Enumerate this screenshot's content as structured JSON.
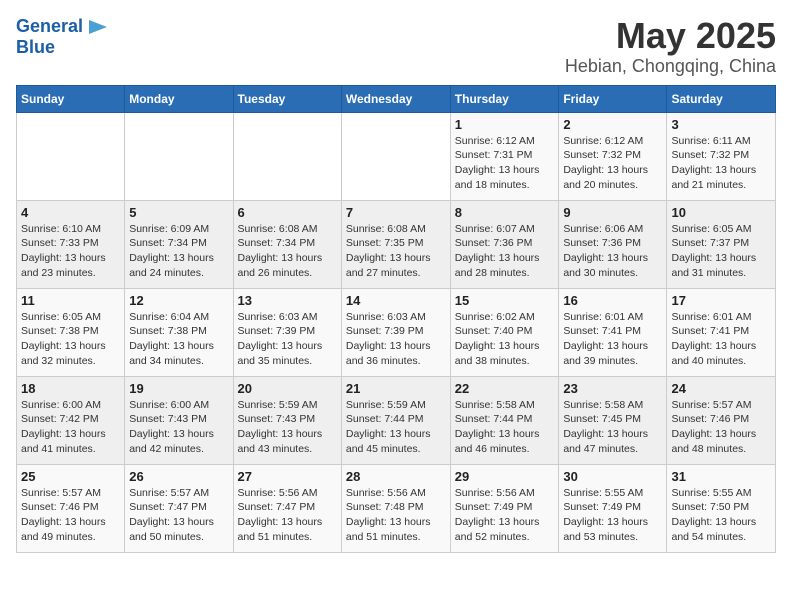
{
  "logo": {
    "line1": "General",
    "line2": "Blue"
  },
  "title": "May 2025",
  "subtitle": "Hebian, Chongqing, China",
  "days_of_week": [
    "Sunday",
    "Monday",
    "Tuesday",
    "Wednesday",
    "Thursday",
    "Friday",
    "Saturday"
  ],
  "weeks": [
    [
      {
        "num": "",
        "detail": ""
      },
      {
        "num": "",
        "detail": ""
      },
      {
        "num": "",
        "detail": ""
      },
      {
        "num": "",
        "detail": ""
      },
      {
        "num": "1",
        "detail": "Sunrise: 6:12 AM\nSunset: 7:31 PM\nDaylight: 13 hours and 18 minutes."
      },
      {
        "num": "2",
        "detail": "Sunrise: 6:12 AM\nSunset: 7:32 PM\nDaylight: 13 hours and 20 minutes."
      },
      {
        "num": "3",
        "detail": "Sunrise: 6:11 AM\nSunset: 7:32 PM\nDaylight: 13 hours and 21 minutes."
      }
    ],
    [
      {
        "num": "4",
        "detail": "Sunrise: 6:10 AM\nSunset: 7:33 PM\nDaylight: 13 hours and 23 minutes."
      },
      {
        "num": "5",
        "detail": "Sunrise: 6:09 AM\nSunset: 7:34 PM\nDaylight: 13 hours and 24 minutes."
      },
      {
        "num": "6",
        "detail": "Sunrise: 6:08 AM\nSunset: 7:34 PM\nDaylight: 13 hours and 26 minutes."
      },
      {
        "num": "7",
        "detail": "Sunrise: 6:08 AM\nSunset: 7:35 PM\nDaylight: 13 hours and 27 minutes."
      },
      {
        "num": "8",
        "detail": "Sunrise: 6:07 AM\nSunset: 7:36 PM\nDaylight: 13 hours and 28 minutes."
      },
      {
        "num": "9",
        "detail": "Sunrise: 6:06 AM\nSunset: 7:36 PM\nDaylight: 13 hours and 30 minutes."
      },
      {
        "num": "10",
        "detail": "Sunrise: 6:05 AM\nSunset: 7:37 PM\nDaylight: 13 hours and 31 minutes."
      }
    ],
    [
      {
        "num": "11",
        "detail": "Sunrise: 6:05 AM\nSunset: 7:38 PM\nDaylight: 13 hours and 32 minutes."
      },
      {
        "num": "12",
        "detail": "Sunrise: 6:04 AM\nSunset: 7:38 PM\nDaylight: 13 hours and 34 minutes."
      },
      {
        "num": "13",
        "detail": "Sunrise: 6:03 AM\nSunset: 7:39 PM\nDaylight: 13 hours and 35 minutes."
      },
      {
        "num": "14",
        "detail": "Sunrise: 6:03 AM\nSunset: 7:39 PM\nDaylight: 13 hours and 36 minutes."
      },
      {
        "num": "15",
        "detail": "Sunrise: 6:02 AM\nSunset: 7:40 PM\nDaylight: 13 hours and 38 minutes."
      },
      {
        "num": "16",
        "detail": "Sunrise: 6:01 AM\nSunset: 7:41 PM\nDaylight: 13 hours and 39 minutes."
      },
      {
        "num": "17",
        "detail": "Sunrise: 6:01 AM\nSunset: 7:41 PM\nDaylight: 13 hours and 40 minutes."
      }
    ],
    [
      {
        "num": "18",
        "detail": "Sunrise: 6:00 AM\nSunset: 7:42 PM\nDaylight: 13 hours and 41 minutes."
      },
      {
        "num": "19",
        "detail": "Sunrise: 6:00 AM\nSunset: 7:43 PM\nDaylight: 13 hours and 42 minutes."
      },
      {
        "num": "20",
        "detail": "Sunrise: 5:59 AM\nSunset: 7:43 PM\nDaylight: 13 hours and 43 minutes."
      },
      {
        "num": "21",
        "detail": "Sunrise: 5:59 AM\nSunset: 7:44 PM\nDaylight: 13 hours and 45 minutes."
      },
      {
        "num": "22",
        "detail": "Sunrise: 5:58 AM\nSunset: 7:44 PM\nDaylight: 13 hours and 46 minutes."
      },
      {
        "num": "23",
        "detail": "Sunrise: 5:58 AM\nSunset: 7:45 PM\nDaylight: 13 hours and 47 minutes."
      },
      {
        "num": "24",
        "detail": "Sunrise: 5:57 AM\nSunset: 7:46 PM\nDaylight: 13 hours and 48 minutes."
      }
    ],
    [
      {
        "num": "25",
        "detail": "Sunrise: 5:57 AM\nSunset: 7:46 PM\nDaylight: 13 hours and 49 minutes."
      },
      {
        "num": "26",
        "detail": "Sunrise: 5:57 AM\nSunset: 7:47 PM\nDaylight: 13 hours and 50 minutes."
      },
      {
        "num": "27",
        "detail": "Sunrise: 5:56 AM\nSunset: 7:47 PM\nDaylight: 13 hours and 51 minutes."
      },
      {
        "num": "28",
        "detail": "Sunrise: 5:56 AM\nSunset: 7:48 PM\nDaylight: 13 hours and 51 minutes."
      },
      {
        "num": "29",
        "detail": "Sunrise: 5:56 AM\nSunset: 7:49 PM\nDaylight: 13 hours and 52 minutes."
      },
      {
        "num": "30",
        "detail": "Sunrise: 5:55 AM\nSunset: 7:49 PM\nDaylight: 13 hours and 53 minutes."
      },
      {
        "num": "31",
        "detail": "Sunrise: 5:55 AM\nSunset: 7:50 PM\nDaylight: 13 hours and 54 minutes."
      }
    ]
  ]
}
